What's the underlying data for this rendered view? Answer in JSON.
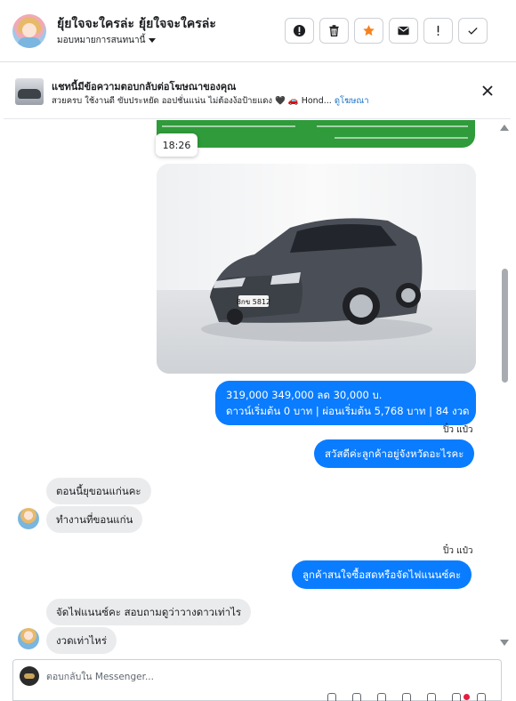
{
  "header": {
    "contact_name": "ยุ้ยใจจะใครล่ะ ยุ้ยใจจะใครล่ะ",
    "assign_label": "มอบหมายการสนทนานี้",
    "actions": [
      {
        "icon": "spam-icon",
        "label": "Mark as spam"
      },
      {
        "icon": "trash-icon",
        "label": "Delete"
      },
      {
        "icon": "star-icon",
        "label": "Star",
        "color": "#f5821f"
      },
      {
        "icon": "mail-icon",
        "label": "Mark as unread"
      },
      {
        "icon": "exclamation-icon",
        "label": "Follow up"
      },
      {
        "icon": "check-icon",
        "label": "Mark as done"
      }
    ]
  },
  "ad_banner": {
    "title": "แชทนี้มีข้อความตอบกลับต่อโฆษณาของคุณ",
    "subtitle": "สวยครบ ใช้งานดี ขับประหยัด ออปชั่นแน่น ไม่ต้องง้อป้ายแดง 🖤 🚗 Hond...",
    "link": "ดูโฆษณา"
  },
  "messages": {
    "time_tooltip": "18:26",
    "price_line1": "319,000 349,000 ลด 30,000 บ.",
    "price_line2": "ดาวน์เริ่มต้น 0 บาท | ผ่อนเริ่มต้น 5,768 บาท | 84 งวด",
    "seen1": "ปิ๋ว แป๋ว",
    "greeting": "สวัสดีค่ะลูกค้าอยู่จังหวัดอะไรคะ",
    "in1": "ตอนนี้ยุขอนแก่นคะ",
    "in2": "ทำงานที่ขอนแก่น",
    "seen2": "ปิ๋ว แป๋ว",
    "out3": "ลูกค้าสนใจซื้อสดหรือจัดไฟแนนซ์คะ",
    "in3": "จัดไฟแนนซ์คะ สอบถามดูว่าวางดาวเท่าไร",
    "in4": "งวดเท่าไหร่"
  },
  "car_plate": "8กข 5812",
  "composer": {
    "placeholder": "ตอบกลับใน Messenger..."
  },
  "colors": {
    "accent": "#0a7cff",
    "star": "#f5821f",
    "ad_green": "#2f9b3a"
  }
}
